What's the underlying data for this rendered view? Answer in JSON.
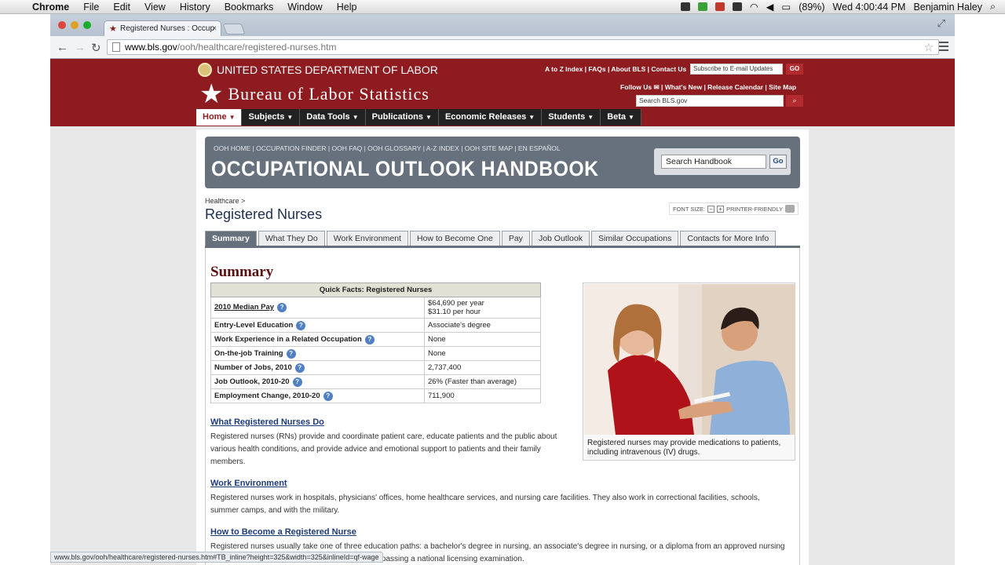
{
  "menubar": {
    "app": "Chrome",
    "items": [
      "File",
      "Edit",
      "View",
      "History",
      "Bookmarks",
      "Window",
      "Help"
    ],
    "battery": "(89%)",
    "clock": "Wed 4:00:44 PM",
    "user": "Benjamin Haley"
  },
  "browser": {
    "tab_title": "Registered Nurses : Occup",
    "url_host": "www.bls.gov",
    "url_path": "/ooh/healthcare/registered-nurses.htm",
    "status_url": "www.bls.gov/ooh/healthcare/registered-nurses.htm#TB_inline?height=325&width=325&inlineId=qf-wage"
  },
  "bls": {
    "department": "UNITED STATES DEPARTMENT OF LABOR",
    "top_links": "A to Z Index  |  FAQs  |  About BLS  |  Contact Us",
    "subscribe_placeholder": "Subscribe to E-mail Updates",
    "go": "GO",
    "title": "Bureau of Labor Statistics",
    "follow_links": "Follow Us ✉ | What's New | Release Calendar | Site Map",
    "search_placeholder": "Search BLS.gov",
    "nav": [
      "Home",
      "Subjects",
      "Data Tools",
      "Publications",
      "Economic Releases",
      "Students",
      "Beta"
    ]
  },
  "ooh": {
    "links": "OOH HOME   |   OCCUPATION FINDER   |   OOH FAQ   |   OOH GLOSSARY   |   A-Z INDEX   |   OOH SITE MAP   |   EN ESPAÑOL",
    "title": "OCCUPATIONAL OUTLOOK HANDBOOK",
    "search_value": "Search Handbook",
    "search_go": "Go",
    "breadcrumb": "Healthcare >",
    "page_title": "Registered Nurses",
    "font_size_label": "FONT SIZE:",
    "printer_label": "PRINTER-FRIENDLY",
    "tabs": [
      "Summary",
      "What They Do",
      "Work Environment",
      "How to Become One",
      "Pay",
      "Job Outlook",
      "Similar Occupations",
      "Contacts for More Info"
    ]
  },
  "summary": {
    "heading": "Summary",
    "table_title": "Quick Facts: Registered Nurses",
    "rows": [
      {
        "key": "2010 Median Pay",
        "value": "$64,690 per year",
        "value2": "$31.10 per hour"
      },
      {
        "key": "Entry-Level Education",
        "value": "Associate's degree"
      },
      {
        "key": "Work Experience in a Related Occupation",
        "value": "None"
      },
      {
        "key": "On-the-job Training",
        "value": "None"
      },
      {
        "key": "Number of Jobs, 2010",
        "value": "2,737,400"
      },
      {
        "key": "Job Outlook, 2010-20",
        "value": "26% (Faster than average)"
      },
      {
        "key": "Employment Change, 2010-20",
        "value": "711,900"
      }
    ],
    "photo_caption": "Registered nurses may provide medications to patients, including intravenous (IV) drugs."
  },
  "sections": [
    {
      "heading": "What Registered Nurses Do",
      "text": "Registered nurses (RNs) provide and coordinate patient care, educate patients and the public about various health conditions, and provide advice and emotional support to patients and their family members."
    },
    {
      "heading": "Work Environment",
      "text": "Registered nurses work in hospitals, physicians' offices, home healthcare services, and nursing care facilities. They also work in correctional facilities, schools, summer camps, and with the military."
    },
    {
      "heading": "How to Become a Registered Nurse",
      "text": "Registered nurses usually take one of three education paths: a bachelor's degree in nursing, an associate's degree in nursing, or a diploma from an approved nursing program. Registered nurses must be licensed by passing a national licensing examination."
    }
  ]
}
